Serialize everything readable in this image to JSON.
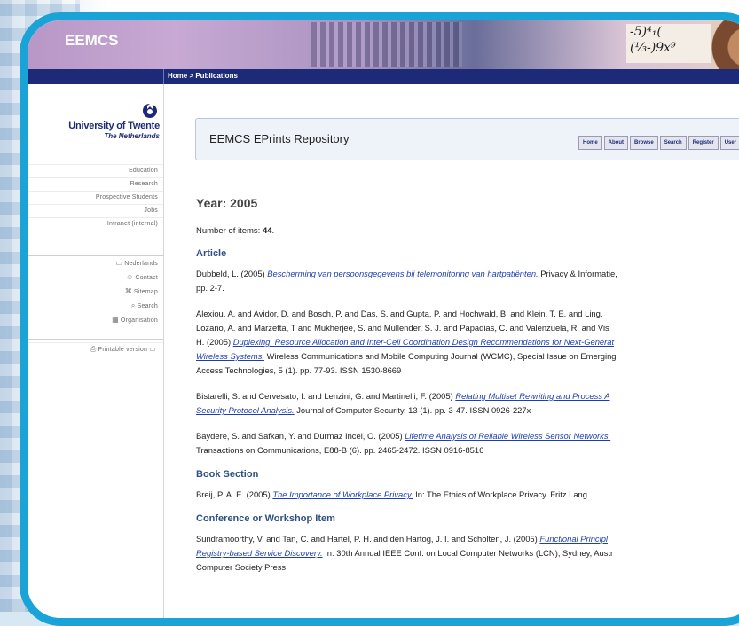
{
  "header": {
    "site_title": "EEMCS",
    "math_snippet_1": "-5)⁴₁(",
    "math_snippet_2": "(⅓-)9x⁹",
    "breadcrumb": "Home > Publications"
  },
  "sidebar": {
    "logo_name": "University of Twente",
    "logo_sub": "The Netherlands",
    "nav": [
      "Education",
      "Research",
      "Prospective Students",
      "Jobs",
      "Intranet (internal)"
    ],
    "utils": [
      {
        "icon": "flag-icon",
        "glyph": "▭",
        "label": "Nederlands"
      },
      {
        "icon": "contact-icon",
        "glyph": "☺",
        "label": "Contact"
      },
      {
        "icon": "sitemap-icon",
        "glyph": "⌘",
        "label": "Sitemap"
      },
      {
        "icon": "search-icon",
        "glyph": "⌕",
        "label": "Search"
      },
      {
        "icon": "organisation-icon",
        "glyph": "▦",
        "label": "Organisation"
      }
    ],
    "print": "Printable version"
  },
  "repo": {
    "title": "EEMCS EPrints Repository",
    "nav": [
      "Home",
      "About",
      "Browse",
      "Search",
      "Register",
      "User"
    ]
  },
  "content": {
    "year_heading": "Year: 2005",
    "count_label": "Number of items: ",
    "count_value": "44",
    "sections": [
      {
        "name": "Article",
        "entries": [
          {
            "pre": "Dubbeld, L. (2005) ",
            "link": "Bescherming van persoonsgegevens bij telemonitoring van hartpatiënten.",
            "post": " Privacy & Informatie,\npp. 2-7."
          },
          {
            "pre": "Alexiou, A. and Avidor, D. and Bosch, P. and Das, S. and Gupta, P. and Hochwald, B. and Klein, T. E. and Ling,\nLozano, A. and Marzetta, T and Mukherjee, S. and Mullender, S. J. and Papadias, C. and Valenzuela, R. and Vis\nH. (2005) ",
            "link": "Duplexing, Resource Allocation and Inter-Cell Coordination Design Recommendations for Next-Generat\nWireless Systems.",
            "post": " Wireless Communications and Mobile Computing Journal (WCMC), Special Issue on Emerging\nAccess Technologies, 5 (1). pp. 77-93. ISSN 1530-8669"
          },
          {
            "pre": "Bistarelli, S. and Cervesato, I. and Lenzini, G. and Martinelli, F. (2005) ",
            "link": "Relating Multiset Rewriting and Process A\nSecurity Protocol Analysis.",
            "post": " Journal of Computer Security, 13 (1). pp. 3-47. ISSN 0926-227x"
          },
          {
            "pre": "Baydere, S. and Safkan, Y. and Durmaz Incel, O. (2005) ",
            "link": "Lifetime Analysis of Reliable Wireless Sensor Networks.",
            "post": "\nTransactions on Communications, E88-B (6). pp. 2465-2472. ISSN 0916-8516"
          }
        ]
      },
      {
        "name": "Book Section",
        "entries": [
          {
            "pre": "Breij, P. A. E. (2005) ",
            "link": "The Importance of Workplace Privacy.",
            "post": " In: The Ethics of Workplace Privacy. Fritz Lang."
          }
        ]
      },
      {
        "name": "Conference or Workshop Item",
        "entries": [
          {
            "pre": "Sundramoorthy, V. and Tan, C. and Hartel, P. H. and den Hartog, J. I. and Scholten, J. (2005) ",
            "link": "Functional Principl\nRegistry-based Service Discovery.",
            "post": " In: 30th Annual IEEE Conf. on Local Computer Networks (LCN), Sydney, Austr\nComputer Society Press."
          }
        ]
      }
    ]
  },
  "colors": {
    "frame": "#1aa3d6",
    "nav_bar": "#1d2a78",
    "section_heading": "#2f4f86",
    "link": "#1c3fb5"
  }
}
